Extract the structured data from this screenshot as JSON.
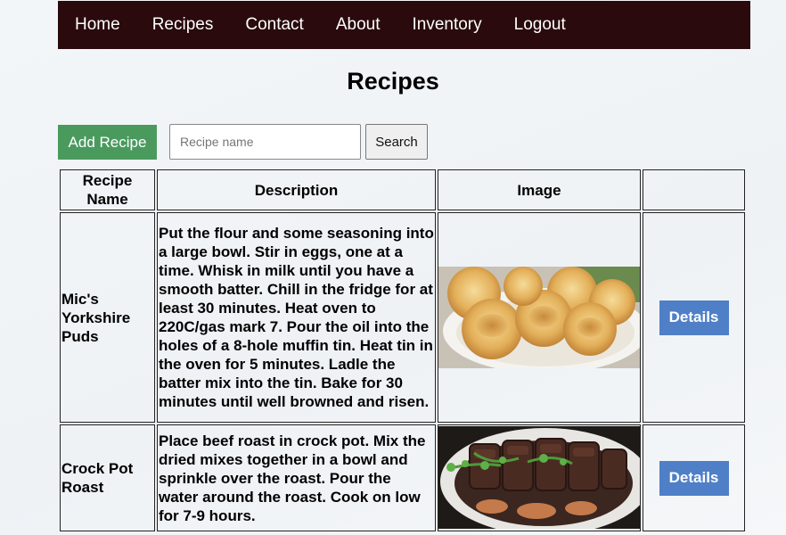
{
  "nav": {
    "items": [
      "Home",
      "Recipes",
      "Contact",
      "About",
      "Inventory",
      "Logout"
    ]
  },
  "page": {
    "title": "Recipes"
  },
  "toolbar": {
    "add_label": "Add Recipe",
    "search_placeholder": "Recipe name",
    "search_label": "Search"
  },
  "table": {
    "headers": {
      "name": "Recipe Name",
      "description": "Description",
      "image": "Image",
      "actions": ""
    },
    "rows": [
      {
        "name": "Mic's Yorkshire Puds",
        "description": "Put the flour and some seasoning into a large bowl. Stir in eggs, one at a time. Whisk in milk until you have a smooth batter. Chill in the fridge for at least 30 minutes. Heat oven to 220C/gas mark 7. Pour the oil into the holes of a 8-hole muffin tin. Heat tin in the oven for 5 minutes. Ladle the batter mix into the tin. Bake for 30 minutes until well browned and risen.",
        "details_label": "Details"
      },
      {
        "name": "Crock Pot Roast",
        "description": "Place beef roast in crock pot. Mix the dried mixes together in a bowl and sprinkle over the roast. Pour the water around the roast. Cook on low for 7-9 hours.",
        "details_label": "Details"
      }
    ]
  },
  "colors": {
    "navbar_bg": "#2a0a0c",
    "add_button": "#4a9a5e",
    "details_button": "#4f7fc7"
  }
}
